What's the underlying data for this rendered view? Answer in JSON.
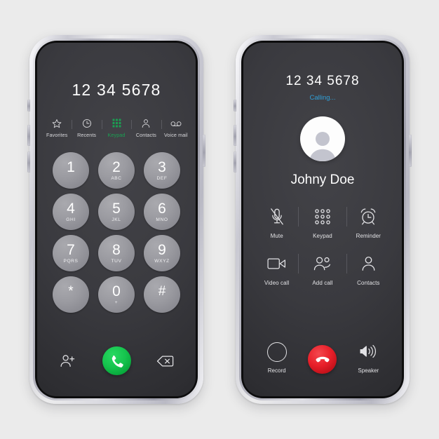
{
  "page": {
    "background_color": "#ebebeb",
    "screen_background_color": "#3a3a3f"
  },
  "dialer_phone": {
    "name": "dialer-screen",
    "number_display": "12 34 5678",
    "tabs": [
      {
        "label": "Favorites",
        "icon": "star-icon",
        "active": false
      },
      {
        "label": "Recents",
        "icon": "clock-icon",
        "active": false
      },
      {
        "label": "Keypad",
        "icon": "grid-icon",
        "active": true
      },
      {
        "label": "Contacts",
        "icon": "person-icon",
        "active": false
      },
      {
        "label": "Voice mail",
        "icon": "voicemail-icon",
        "active": false
      }
    ],
    "active_tab_color": "#1aa052",
    "keys": [
      {
        "digit": "1",
        "letters": ""
      },
      {
        "digit": "2",
        "letters": "ABC"
      },
      {
        "digit": "3",
        "letters": "DEF"
      },
      {
        "digit": "4",
        "letters": "GHI"
      },
      {
        "digit": "5",
        "letters": "JKL"
      },
      {
        "digit": "6",
        "letters": "MNO"
      },
      {
        "digit": "7",
        "letters": "PQRS"
      },
      {
        "digit": "8",
        "letters": "TUV"
      },
      {
        "digit": "9",
        "letters": "WXYZ"
      },
      {
        "digit": "*",
        "letters": ""
      },
      {
        "digit": "0",
        "letters": "+"
      },
      {
        "digit": "#",
        "letters": ""
      }
    ],
    "key_color": "#9b9ba1",
    "actions": {
      "add_contact_icon": "person-add-icon",
      "call_icon": "phone-handset-icon",
      "call_button_color": "#16c44e",
      "backspace_icon": "backspace-icon"
    }
  },
  "calling_phone": {
    "name": "calling-screen",
    "number_display": "12 34 5678",
    "status": "Calling...",
    "status_color": "#2f9fd8",
    "avatar_icon": "person-avatar-icon",
    "caller_name": "Johny Doe",
    "controls": [
      {
        "label": "Mute",
        "icon": "microphone-muted-icon"
      },
      {
        "label": "Keypad",
        "icon": "keypad-dots-icon"
      },
      {
        "label": "Reminder",
        "icon": "alarm-clock-icon"
      },
      {
        "label": "Video call",
        "icon": "video-camera-icon"
      },
      {
        "label": "Add call",
        "icon": "person-add-group-icon"
      },
      {
        "label": "Contacts",
        "icon": "person-icon"
      }
    ],
    "bottom": {
      "record_label": "Record",
      "record_icon": "record-circle-icon",
      "hangup_icon": "phone-hangup-icon",
      "hangup_color": "#e8202a",
      "speaker_label": "Speaker",
      "speaker_icon": "speaker-icon"
    }
  }
}
